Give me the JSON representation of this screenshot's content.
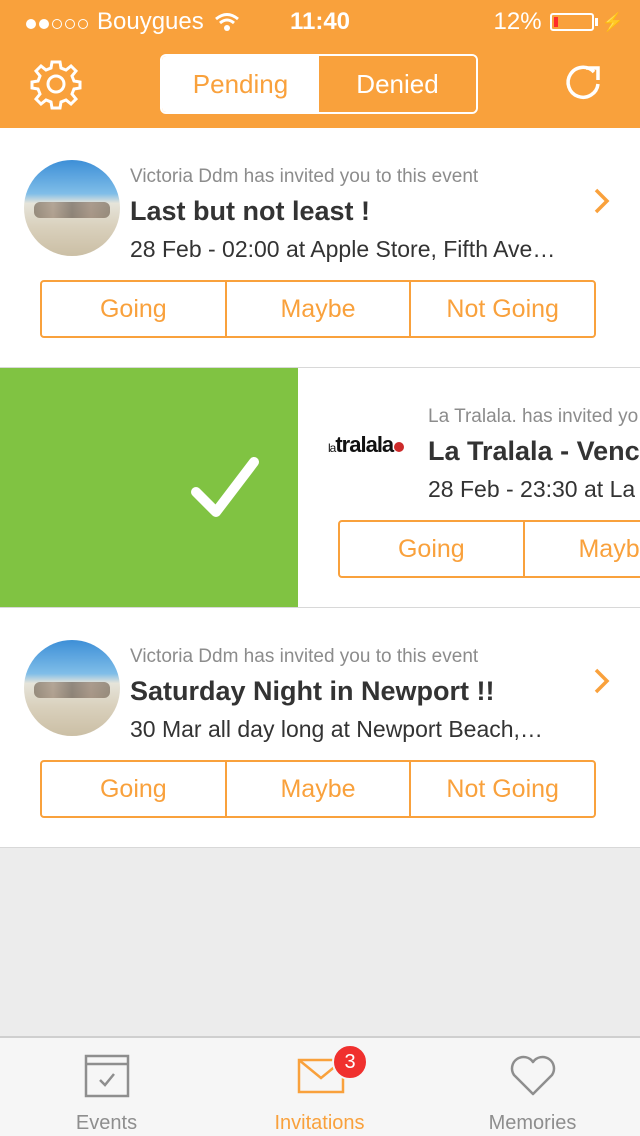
{
  "status_bar": {
    "carrier": "Bouygues",
    "time": "11:40",
    "battery": "12%",
    "battery_level": 0.12
  },
  "header": {
    "tabs": [
      {
        "label": "Pending",
        "selected": true
      },
      {
        "label": "Denied",
        "selected": false
      }
    ]
  },
  "invitations": [
    {
      "inviter": "Victoria Ddm has invited you to this event",
      "title": "Last but not least !",
      "detail": "28 Feb - 02:00 at Apple Store, Fifth Ave…",
      "actions": [
        "Going",
        "Maybe",
        "Not Going"
      ]
    },
    {
      "inviter": "La Tralala. has invited yo",
      "title": "La Tralala - Venc",
      "detail": "28 Feb - 23:30 at La",
      "logo_text": "latralala",
      "actions": [
        "Going",
        "Maybe"
      ]
    },
    {
      "inviter": "Victoria Ddm has invited you to this event",
      "title": "Saturday Night in Newport !!",
      "detail": "30 Mar all day long at Newport Beach,…",
      "actions": [
        "Going",
        "Maybe",
        "Not Going"
      ]
    }
  ],
  "tabbar": {
    "tabs": [
      {
        "label": "Events",
        "icon": "calendar-check-icon",
        "active": false
      },
      {
        "label": "Invitations",
        "icon": "envelope-icon",
        "active": true,
        "badge": "3"
      },
      {
        "label": "Memories",
        "icon": "heart-icon",
        "active": false
      }
    ]
  },
  "colors": {
    "accent": "#f9a13c",
    "swipe_accept": "#80c342",
    "badge": "#f0302e"
  }
}
